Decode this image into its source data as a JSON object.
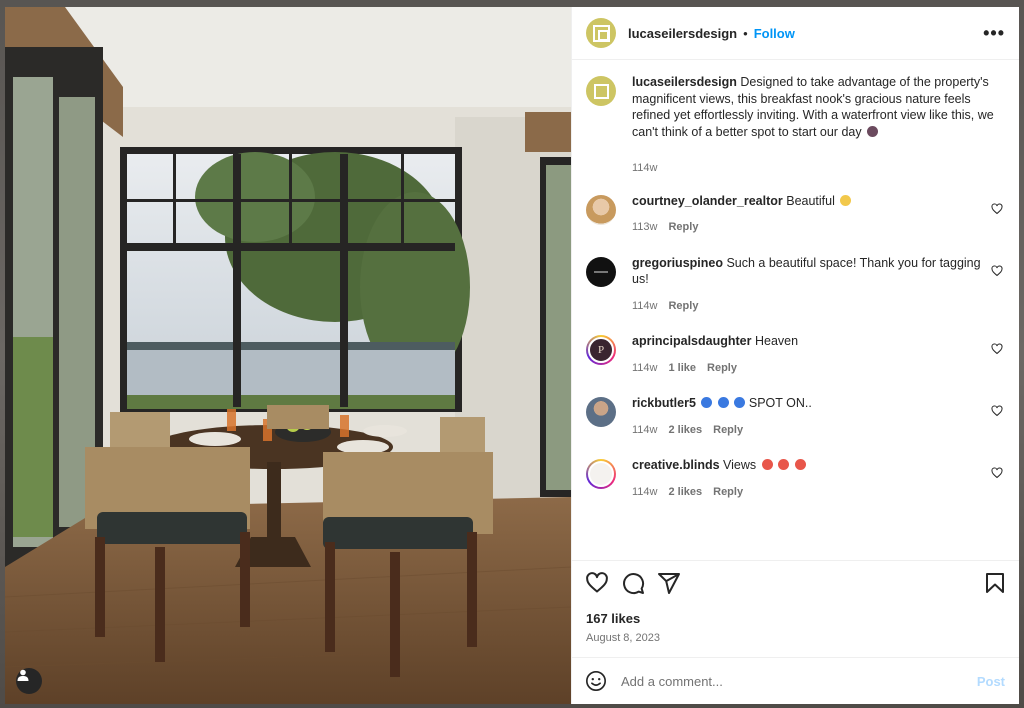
{
  "post": {
    "username": "lucaseilersdesign",
    "dot": "•",
    "follow_label": "Follow",
    "more_icon": "more-options-icon",
    "caption_text": "Designed to take advantage of the property's magnificent views, this breakfast nook's gracious nature feels refined yet effortlessly inviting. With a waterfront view like this, we can't think of a better spot to start our day",
    "caption_time": "114w",
    "likes": "167 likes",
    "date": "August 8, 2023",
    "add_comment_placeholder": "Add a comment...",
    "post_label": "Post"
  },
  "comments": [
    {
      "username": "courtney_olander_realtor",
      "text": "Beautiful",
      "time": "113w",
      "likes": "",
      "reply": "Reply",
      "emoji": "clapping-hands-icon"
    },
    {
      "username": "gregoriuspineo",
      "text": "Such a beautiful space! Thank you for tagging us!",
      "time": "114w",
      "likes": "",
      "reply": "Reply"
    },
    {
      "username": "aprincipalsdaughter",
      "text": "Heaven",
      "time": "114w",
      "likes": "1 like",
      "reply": "Reply"
    },
    {
      "username": "rickbutler5",
      "text": "SPOT ON..",
      "time": "114w",
      "likes": "2 likes",
      "reply": "Reply",
      "emoji": "blue-heart-icon"
    },
    {
      "username": "creative.blinds",
      "text": "Views",
      "time": "114w",
      "likes": "2 likes",
      "reply": "Reply",
      "emoji": "heart-eyes-icon"
    }
  ],
  "colors": {
    "follow": "#0095f6",
    "post_disabled": "#b3dbff",
    "logo": "#cdc563"
  }
}
